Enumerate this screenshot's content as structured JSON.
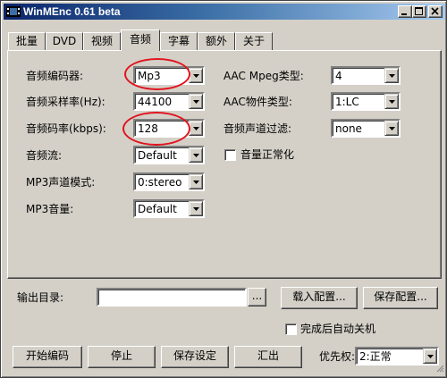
{
  "window": {
    "title": "WinMEnc 0.61 beta"
  },
  "tabs": [
    {
      "label": "批量"
    },
    {
      "label": "DVD"
    },
    {
      "label": "视频"
    },
    {
      "label": "音频"
    },
    {
      "label": "字幕"
    },
    {
      "label": "额外"
    },
    {
      "label": "关于"
    }
  ],
  "active_tab": "音频",
  "audio": {
    "encoder_label": "音频编码器:",
    "encoder_value": "Mp3",
    "samplerate_label": "音频采样率(Hz):",
    "samplerate_value": "44100",
    "bitrate_label": "音频码率(kbps):",
    "bitrate_value": "128",
    "stream_label": "音频流:",
    "stream_value": "Default",
    "mp3_mode_label": "MP3声道模式:",
    "mp3_mode_value": "0:stereo",
    "mp3_volume_label": "MP3音量:",
    "mp3_volume_value": "Default",
    "aac_mpeg_label": "AAC Mpeg类型:",
    "aac_mpeg_value": "4",
    "aac_object_label": "AAC物件类型:",
    "aac_object_value": "1:LC",
    "channel_filter_label": "音频声道过滤:",
    "channel_filter_value": "none",
    "normalize_label": "音量正常化"
  },
  "output": {
    "dir_label": "输出目录:",
    "dir_value": "",
    "browse_label": "...",
    "load_config": "载入配置...",
    "save_config": "保存配置...",
    "shutdown_label": "完成后自动关机"
  },
  "bottom": {
    "start": "开始编码",
    "stop": "停止",
    "save_settings": "保存设定",
    "export": "汇出",
    "priority_label": "优先权:",
    "priority_value": "2:正常"
  },
  "annotations_color": "#e0141e"
}
